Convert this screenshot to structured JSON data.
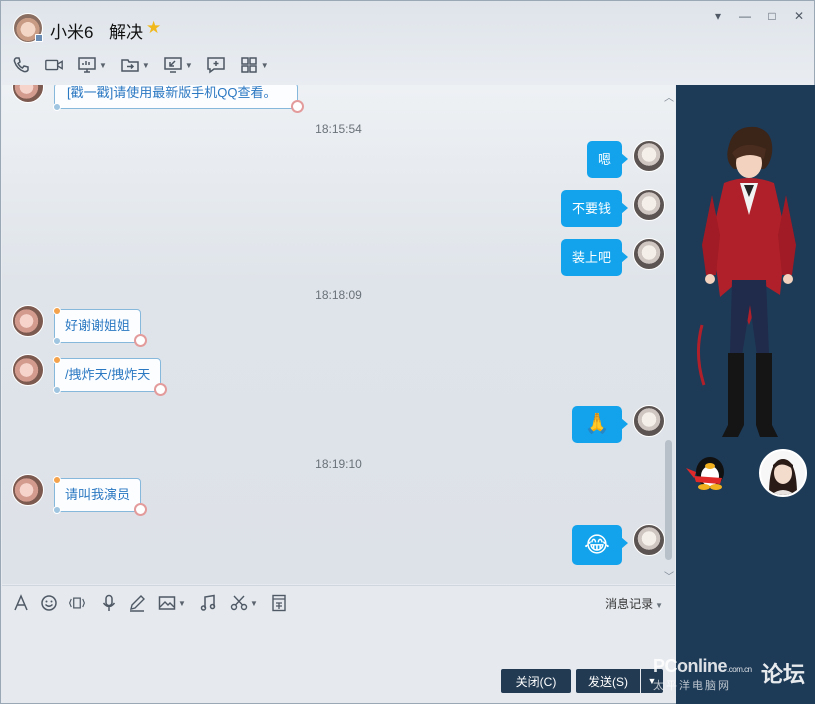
{
  "header": {
    "contact_name": "小米6",
    "contact_note": "解决",
    "star": "★",
    "window_controls": [
      "▾",
      "—",
      "□",
      "✕"
    ]
  },
  "toolbar": {
    "items": [
      "phone-call",
      "video-call",
      "screen-share",
      "file-transfer",
      "remote-desktop",
      "new-discussion",
      "apps"
    ]
  },
  "messages": {
    "cut_message": "[戳一戳]请使用最新版手机QQ查看。",
    "ts1": "18:15:54",
    "out1": "嗯",
    "out2": "不要钱",
    "out3": "装上吧",
    "ts2": "18:18:09",
    "in1": "好谢谢姐姐",
    "in2": "/拽炸天/拽炸天",
    "out4_emoji": "🙏",
    "ts3": "18:19:10",
    "in3": "请叫我演员",
    "out5_emoji": "😂"
  },
  "input": {
    "history_label": "消息记录",
    "close_button": "关闭(C)",
    "send_button": "发送(S)"
  },
  "watermark": {
    "brand": "PConline",
    "domain": ".com.cn",
    "sub": "太平洋电脑网",
    "forum": "论坛"
  },
  "colors": {
    "bubble_out": "#12a3ec",
    "side_panel": "#1d3a57",
    "button": "#223a52"
  }
}
